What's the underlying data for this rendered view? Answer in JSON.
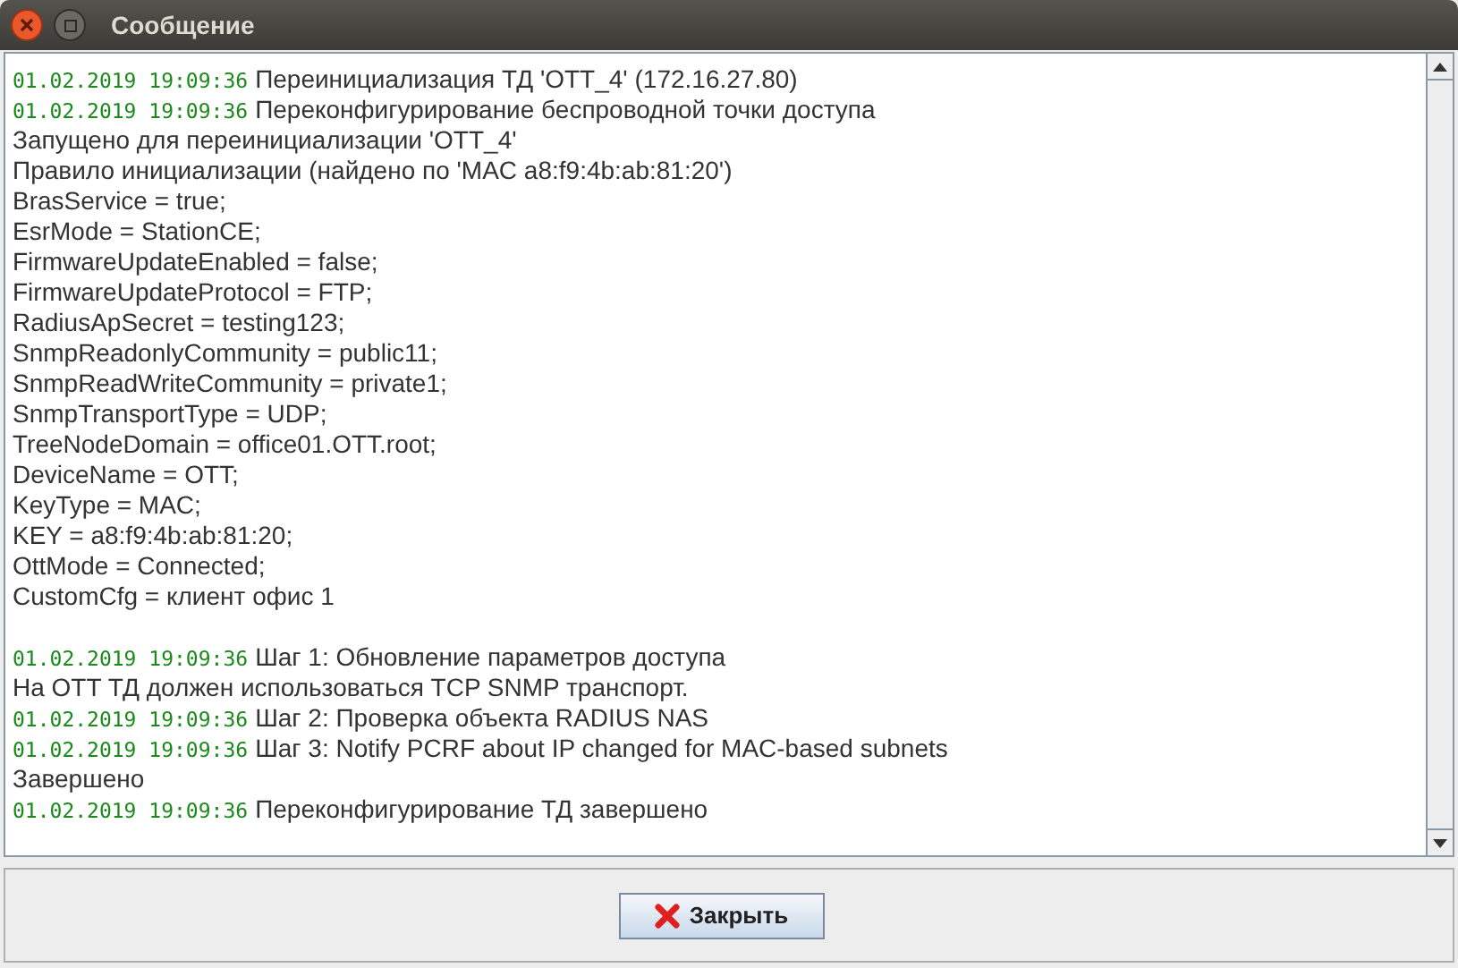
{
  "window": {
    "title": "Сообщение"
  },
  "log": {
    "blocks": [
      {
        "lines": [
          {
            "timestamp": "01.02.2019 19:09:36",
            "text": "Переинициализация ТД 'OTT_4' (172.16.27.80)"
          },
          {
            "timestamp": "01.02.2019 19:09:36",
            "text": "Переконфигурирование беспроводной точки доступа"
          },
          {
            "text": "Запущено для переинициализации 'OTT_4'"
          },
          {
            "text": "Правило инициализации (найдено по 'MAC a8:f9:4b:ab:81:20')"
          },
          {
            "text": "BrasService = true;"
          },
          {
            "text": "EsrMode = StationCE;"
          },
          {
            "text": "FirmwareUpdateEnabled = false;"
          },
          {
            "text": "FirmwareUpdateProtocol = FTP;"
          },
          {
            "text": "RadiusApSecret = testing123;"
          },
          {
            "text": "SnmpReadonlyCommunity = public11;"
          },
          {
            "text": "SnmpReadWriteCommunity = private1;"
          },
          {
            "text": "SnmpTransportType = UDP;"
          },
          {
            "text": "TreeNodeDomain = office01.OTT.root;"
          },
          {
            "text": "DeviceName = OTT;"
          },
          {
            "text": "KeyType = MAC;"
          },
          {
            "text": "KEY = a8:f9:4b:ab:81:20;"
          },
          {
            "text": "OttMode = Connected;"
          },
          {
            "text": "CustomCfg = клиент офис 1"
          }
        ]
      },
      {
        "lines": [
          {
            "timestamp": "01.02.2019 19:09:36",
            "text": "Шаг 1: Обновление параметров доступа"
          },
          {
            "text": "На OTT ТД должен использоваться TCP SNMP транспорт."
          },
          {
            "timestamp": "01.02.2019 19:09:36",
            "text": "Шаг 2: Проверка объекта RADIUS NAS"
          },
          {
            "timestamp": "01.02.2019 19:09:36",
            "text": "Шаг 3: Notify PCRF about IP changed for MAC-based subnets"
          },
          {
            "text": "Завершено"
          },
          {
            "timestamp": "01.02.2019 19:09:36",
            "text": "Переконфигурирование ТД завершено"
          }
        ]
      }
    ]
  },
  "buttons": [
    {
      "label": "Закрыть"
    }
  ]
}
